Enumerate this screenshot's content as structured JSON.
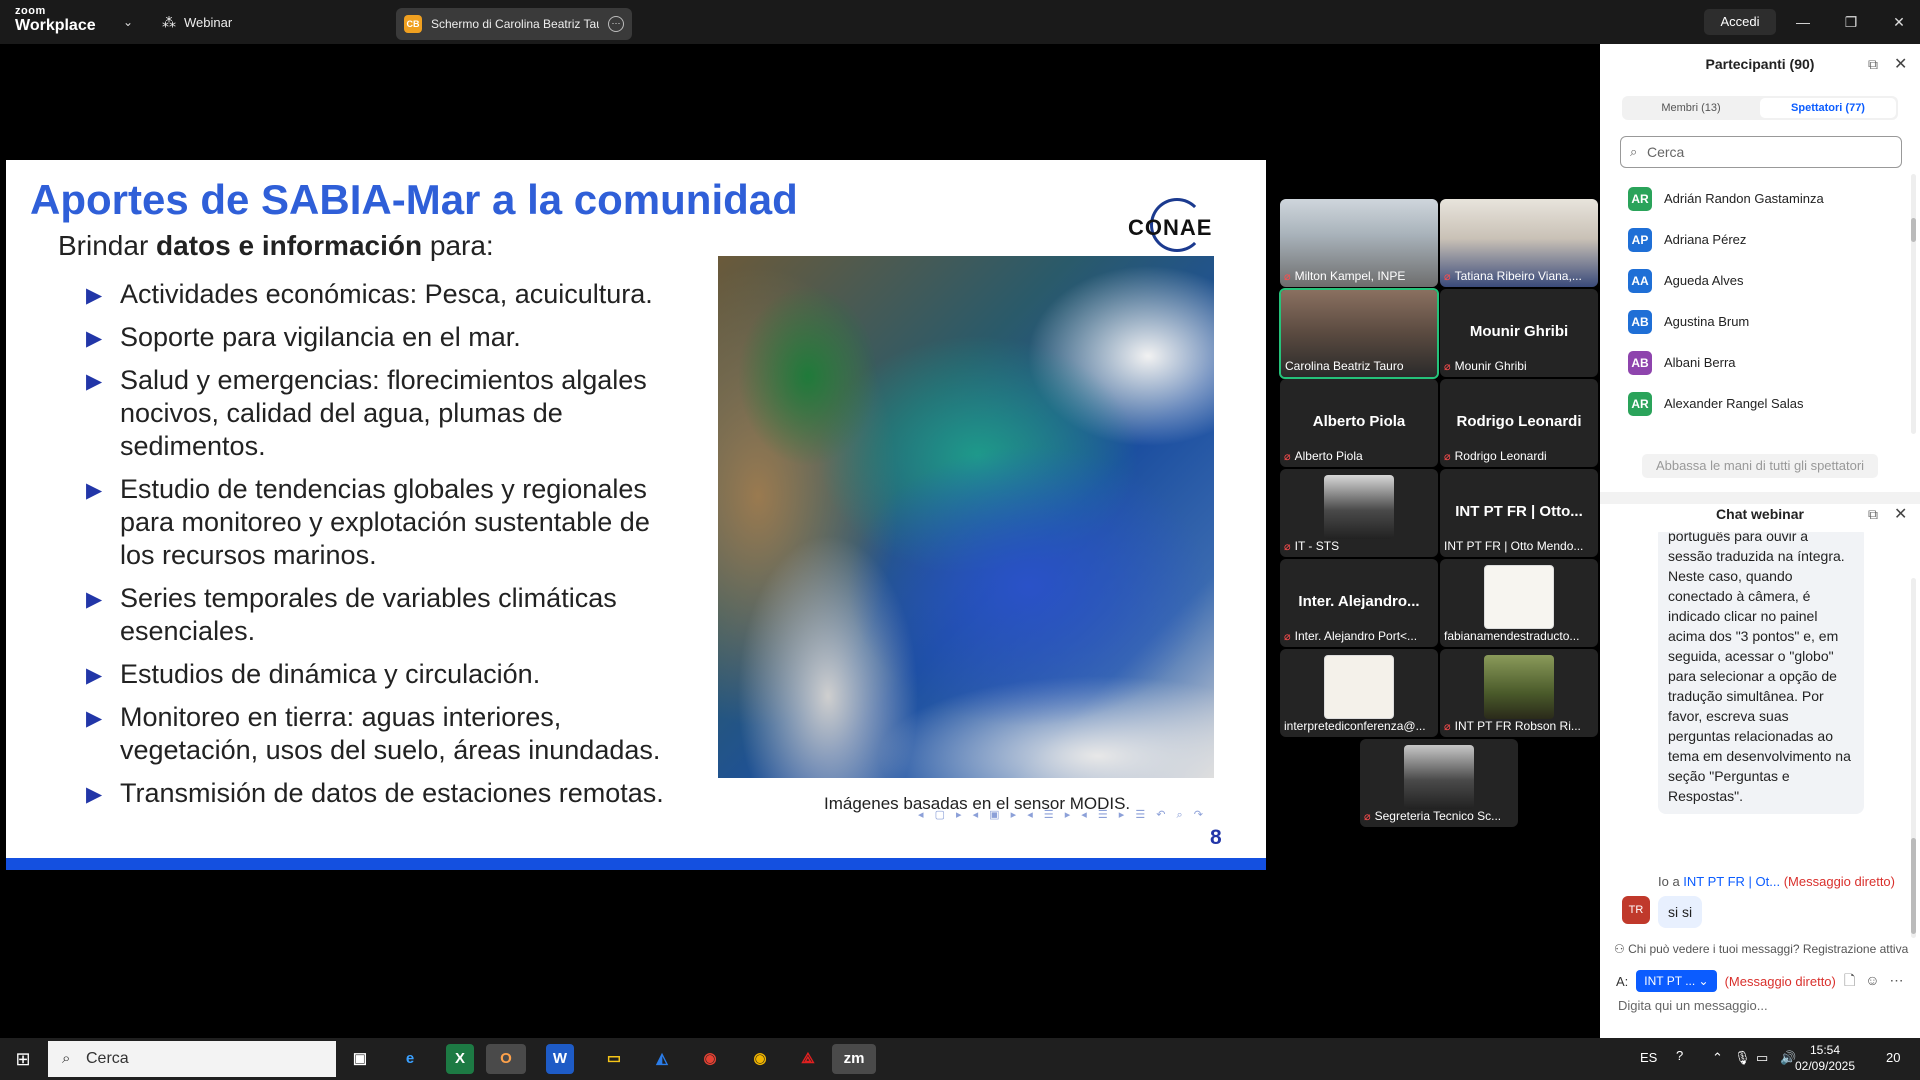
{
  "topbar": {
    "logo_line1": "zoom",
    "logo_line2": "Workplace",
    "webinar_label": "Webinar",
    "share_badge": "CB",
    "share_label": "Schermo di Carolina Beatriz Tauro",
    "login_label": "Accedi"
  },
  "slide": {
    "title": "Aportes de SABIA-Mar a la comunidad",
    "subtitle_pre": "Brindar ",
    "subtitle_bold": "datos e información",
    "subtitle_post": " para:",
    "logo_text": "CONAE",
    "bullets": [
      "Actividades económicas: Pesca, acuicultura.",
      "Soporte para vigilancia en el mar.",
      "Salud y emergencias: florecimientos algales nocivos, calidad del agua, plumas de sedimentos.",
      "Estudio de tendencias globales y regionales para monitoreo y explotación sustentable de los recursos marinos.",
      "Series temporales de variables climáticas esenciales.",
      "Estudios de dinámica y circulación.",
      "Monitoreo en tierra: aguas interiores, vegetación, usos del suelo, áreas inundadas.",
      "Transmisión de datos de estaciones remotas."
    ],
    "caption": "Imágenes basadas en el sensor MODIS.",
    "page_number": "8"
  },
  "videos": [
    {
      "name": "Milton Kampel, INPE",
      "big": ""
    },
    {
      "name": "Tatiana Ribeiro Viana,...",
      "big": ""
    },
    {
      "name": "Carolina Beatriz Tauro",
      "big": ""
    },
    {
      "name": "Mounir Ghribi",
      "big": "Mounir Ghribi"
    },
    {
      "name": "Alberto Piola",
      "big": "Alberto Piola"
    },
    {
      "name": "Rodrigo Leonardi",
      "big": "Rodrigo Leonardi"
    },
    {
      "name": "IT - STS",
      "big": ""
    },
    {
      "name": "INT PT FR | Otto Mendo...",
      "big": "INT PT FR | Otto..."
    },
    {
      "name": "Inter. Alejandro Port<...",
      "big": "Inter.  Alejandro..."
    },
    {
      "name": "fabianamendestraducto...",
      "big": ""
    },
    {
      "name": "interpretediconferenza@...",
      "big": ""
    },
    {
      "name": "INT PT FR Robson Ri...",
      "big": ""
    },
    {
      "name": "Segreteria Tecnico Sc...",
      "big": ""
    }
  ],
  "participants": {
    "title": "Partecipanti (90)",
    "tab_members": "Membri (13)",
    "tab_viewers": "Spettatori (77)",
    "search_placeholder": "Cerca",
    "list": [
      {
        "initials": "AR",
        "name": "Adrián Randon Gastaminza",
        "color": "#2aa35a"
      },
      {
        "initials": "AP",
        "name": "Adriana Pérez",
        "color": "#1f6fd6"
      },
      {
        "initials": "AA",
        "name": "Agueda Alves",
        "color": "#1f6fd6"
      },
      {
        "initials": "AB",
        "name": "Agustina Brum",
        "color": "#1f6fd6"
      },
      {
        "initials": "AB",
        "name": "Albani Berra",
        "color": "#8e44ad"
      },
      {
        "initials": "AR",
        "name": "Alexander Rangel Salas",
        "color": "#2aa35a"
      }
    ],
    "lower_hands": "Abbassa le mani di tutti gli spettatori"
  },
  "chat": {
    "title": "Chat webinar",
    "message": "português para ouvir a sessão traduzida na íntegra. Neste caso, quando conectado à câmera, é indicado clicar no painel acima dos \"3 pontos\" e, em seguida, acessar o \"globo\" para selecionar a opção de tradução simultânea. Por favor, escreva suas perguntas relacionadas ao tema em desenvolvimento na seção \"Perguntas e Respostas\".",
    "to_prefix": "Io a ",
    "to_who": "INT PT FR | Ot...",
    "to_dm": "(Messaggio diretto)",
    "sender_initials": "TR",
    "reply": "si si",
    "visibility": "Chi può vedere i tuoi messaggi? Registrazione attiva",
    "to_label": "A:",
    "to_select": "INT PT ...",
    "to_select_dm": "(Messaggio diretto)",
    "input_placeholder": "Digita qui un messaggio..."
  },
  "taskbar": {
    "search_label": "Cerca",
    "lang": "ES",
    "time": "15:54",
    "date": "02/09/2025",
    "notif_count": "20"
  }
}
